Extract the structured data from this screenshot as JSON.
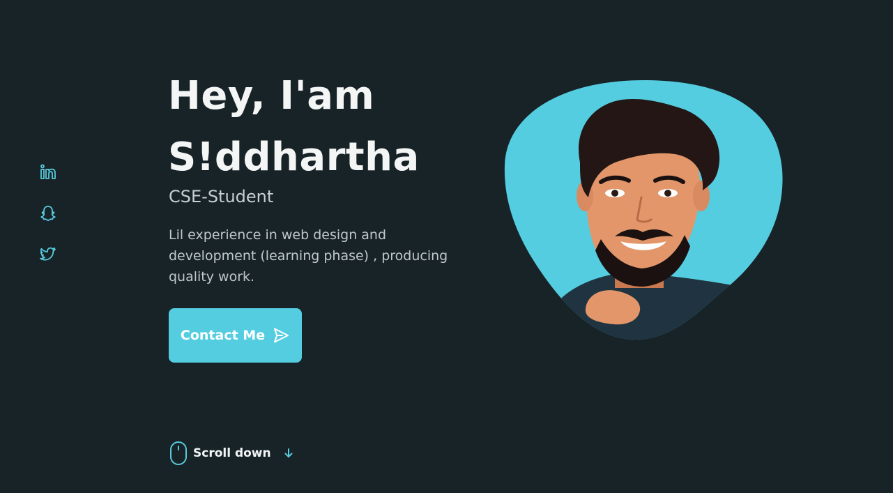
{
  "social": [
    {
      "name": "linkedin-icon",
      "label": "LinkedIn"
    },
    {
      "name": "snapchat-icon",
      "label": "Snapchat"
    },
    {
      "name": "twitter-icon",
      "label": "Twitter"
    }
  ],
  "hero": {
    "title_line1": "Hey, I'am",
    "title_line2": "S!ddhartha",
    "subtitle": "CSE-Student",
    "description": "Lil experience in web design and development (learning phase) , producing quality work.",
    "button_label": "Contact Me"
  },
  "scroll": {
    "label": "Scroll down"
  },
  "colors": {
    "background": "#182328",
    "accent": "#55cde0",
    "title": "#f4f6f6",
    "text": "#c0c8cb"
  },
  "icons": {
    "button": "send-icon",
    "scroll_mouse": "mouse-icon",
    "scroll_arrow": "arrow-down-icon"
  }
}
